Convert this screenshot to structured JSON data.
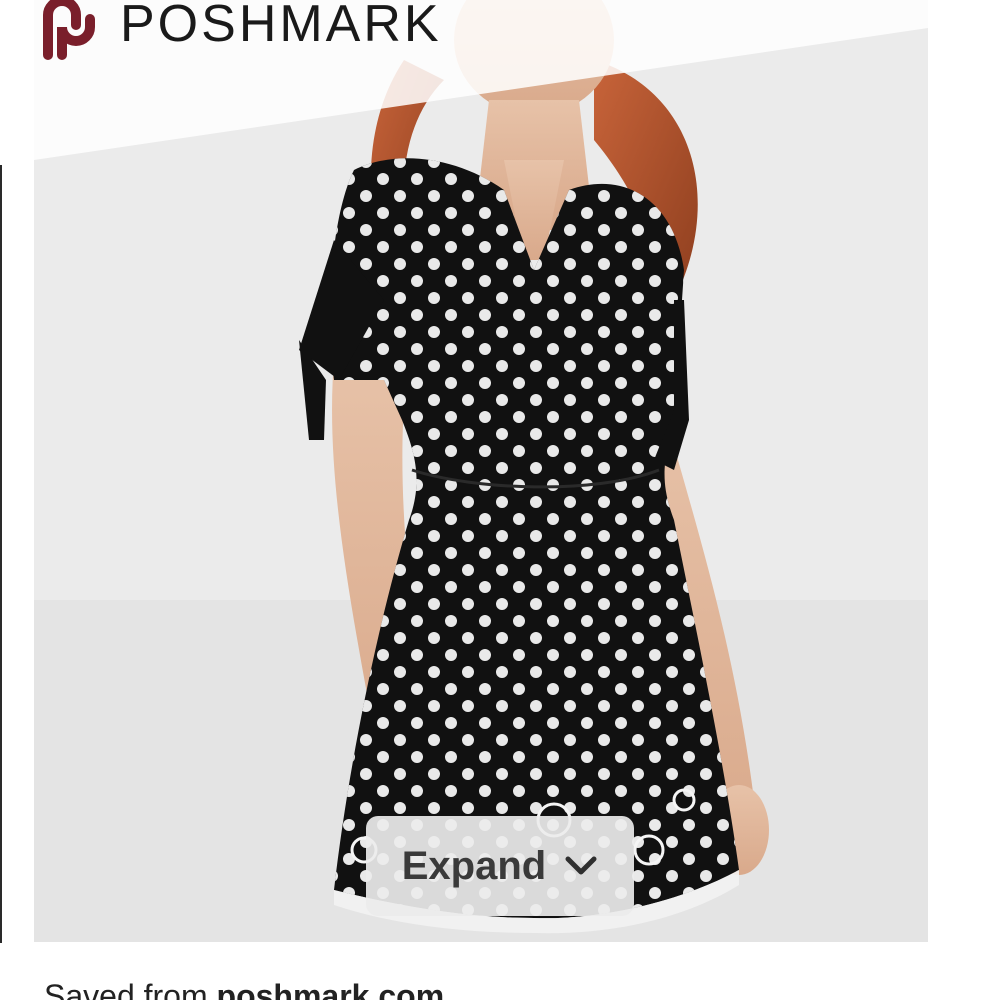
{
  "brand": {
    "name": "POSHMARK",
    "logo_icon": "poshmark-logo-icon",
    "accent_color": "#7a1f2b"
  },
  "pin": {
    "image_alt": "Model wearing black polka-dot wrap mini dress with eyelet scalloped hem",
    "expand_label": "Expand",
    "expand_icon": "chevron-down-icon"
  },
  "source": {
    "prefix": "Saved from",
    "domain": "poshmark.com"
  }
}
